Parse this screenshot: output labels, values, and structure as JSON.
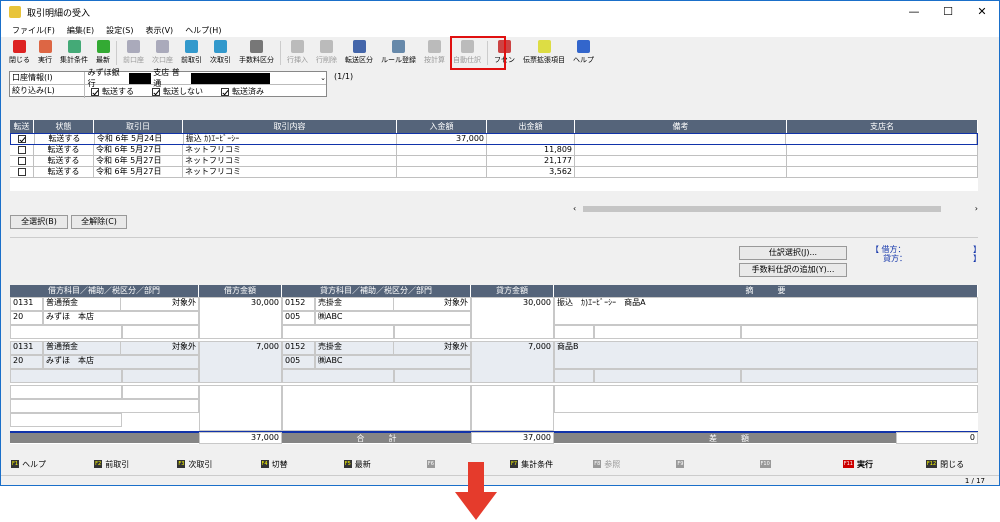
{
  "window": {
    "title": "取引明細の受入",
    "min": "—",
    "max": "☐",
    "close": "✕"
  },
  "menu": [
    "ファイル(F)",
    "編集(E)",
    "設定(S)",
    "表示(V)",
    "ヘルプ(H)"
  ],
  "toolbar": [
    {
      "label": "閉じる",
      "color": "#d22",
      "dis": false
    },
    {
      "label": "実行",
      "color": "#d64",
      "dis": false
    },
    {
      "label": "集計条件",
      "color": "#4a7",
      "dis": false
    },
    {
      "label": "最新",
      "color": "#3a3",
      "dis": false
    },
    {
      "sep": true
    },
    {
      "label": "前口座",
      "color": "#aab",
      "dis": true
    },
    {
      "label": "次口座",
      "color": "#aab",
      "dis": true
    },
    {
      "label": "前取引",
      "color": "#39c",
      "dis": false
    },
    {
      "label": "次取引",
      "color": "#39c",
      "dis": false
    },
    {
      "label": "手数料区分",
      "color": "#777",
      "dis": false
    },
    {
      "sep": true
    },
    {
      "label": "行挿入",
      "color": "#bbb",
      "dis": true
    },
    {
      "label": "行削除",
      "color": "#bbb",
      "dis": true
    },
    {
      "label": "転送区分",
      "color": "#46a",
      "dis": false
    },
    {
      "label": "ルール登録",
      "color": "#6789aa",
      "dis": false
    },
    {
      "label": "按計算",
      "color": "#bbb",
      "dis": true
    },
    {
      "label": "自動仕訳",
      "color": "#bbb",
      "dis": true
    },
    {
      "sep": true
    },
    {
      "label": "フセン",
      "color": "#c44",
      "dis": false
    },
    {
      "label": "伝票拡張項目",
      "color": "#dd4",
      "dis": false
    },
    {
      "label": "ヘルプ",
      "color": "#36c",
      "dis": false
    }
  ],
  "account": {
    "label1": "口座情報(I)",
    "bank": "みずほ銀行",
    "branch": "支店 普通",
    "page": "(1/1)",
    "label2": "絞り込み(L)",
    "f1": "転送する",
    "f2": "転送しない",
    "f3": "転送済み"
  },
  "grid1": {
    "headers": [
      "転送",
      "状態",
      "取引日",
      "取引内容",
      "入金額",
      "出金額",
      "備考",
      "支店名"
    ],
    "rows": [
      {
        "chk": true,
        "st": "転送する",
        "date": "令和 6年 5月24日",
        "desc": "振込 ｶ)ｴｰﾋﾞｰｼｰ",
        "in": "37,000",
        "out": ""
      },
      {
        "chk": false,
        "st": "転送する",
        "date": "令和 6年 5月27日",
        "desc": "ネットフリコミ",
        "in": "",
        "out": "11,809"
      },
      {
        "chk": false,
        "st": "転送する",
        "date": "令和 6年 5月27日",
        "desc": "ネットフリコミ",
        "in": "",
        "out": "21,177"
      },
      {
        "chk": false,
        "st": "転送する",
        "date": "令和 6年 5月27日",
        "desc": "ネットフリコミ",
        "in": "",
        "out": "3,562"
      }
    ]
  },
  "buttons": {
    "selall": "全選択(B)",
    "unselall": "全解除(C)",
    "shiwake": "仕訳選択(J)...",
    "fee": "手数料仕訳の追加(Y)..."
  },
  "lr": {
    "l1": "【 借方：",
    "l2": "貸方：",
    "r": "】"
  },
  "grid2": {
    "headers": [
      "借方科目／補助／税区分／部門",
      "借方金額",
      "貸方科目／補助／税区分／部門",
      "貸方金額",
      "摘　　　要"
    ],
    "r1": {
      "dc": "0131",
      "dn": "普通預金",
      "dt": "対象外",
      "ds": "20",
      "dsn": "みずほ　本店",
      "damt": "30,000",
      "cc": "0152",
      "cn": "売掛金",
      "ct": "対象外",
      "cs": "005",
      "csn": "㈱ABC",
      "camt": "30,000",
      "memo": "振込　ｶ)ｴｰﾋﾞｰｼｰ　商品A"
    },
    "r2": {
      "dc": "0131",
      "dn": "普通預金",
      "dt": "対象外",
      "ds": "20",
      "dsn": "みずほ　本店",
      "damt": "7,000",
      "cc": "0152",
      "cn": "売掛金",
      "ct": "対象外",
      "cs": "005",
      "csn": "㈱ABC",
      "camt": "7,000",
      "memo": "商品B"
    },
    "total_d": "37,000",
    "total_lbl": "合　　　計",
    "total_c": "37,000",
    "diff_lbl": "差　　　額",
    "diff": "0"
  },
  "fkeys": [
    {
      "k": "F1",
      "l": "ヘルプ",
      "dim": false
    },
    {
      "k": "F2",
      "l": "前取引",
      "dim": false
    },
    {
      "k": "F3",
      "l": "次取引",
      "dim": false
    },
    {
      "k": "F4",
      "l": "切替",
      "dim": false
    },
    {
      "k": "F5",
      "l": "最新",
      "dim": false
    },
    {
      "k": "F6",
      "l": "",
      "dim": true
    },
    {
      "k": "F7",
      "l": "集計条件",
      "dim": false
    },
    {
      "k": "F8",
      "l": "参照",
      "dim": true
    },
    {
      "k": "F9",
      "l": "",
      "dim": true
    },
    {
      "k": "F10",
      "l": "",
      "dim": true
    },
    {
      "k": "F11",
      "l": "実行",
      "dim": false,
      "red": true
    },
    {
      "k": "F12",
      "l": "閉じる",
      "dim": false
    }
  ],
  "status": "1 / 17"
}
